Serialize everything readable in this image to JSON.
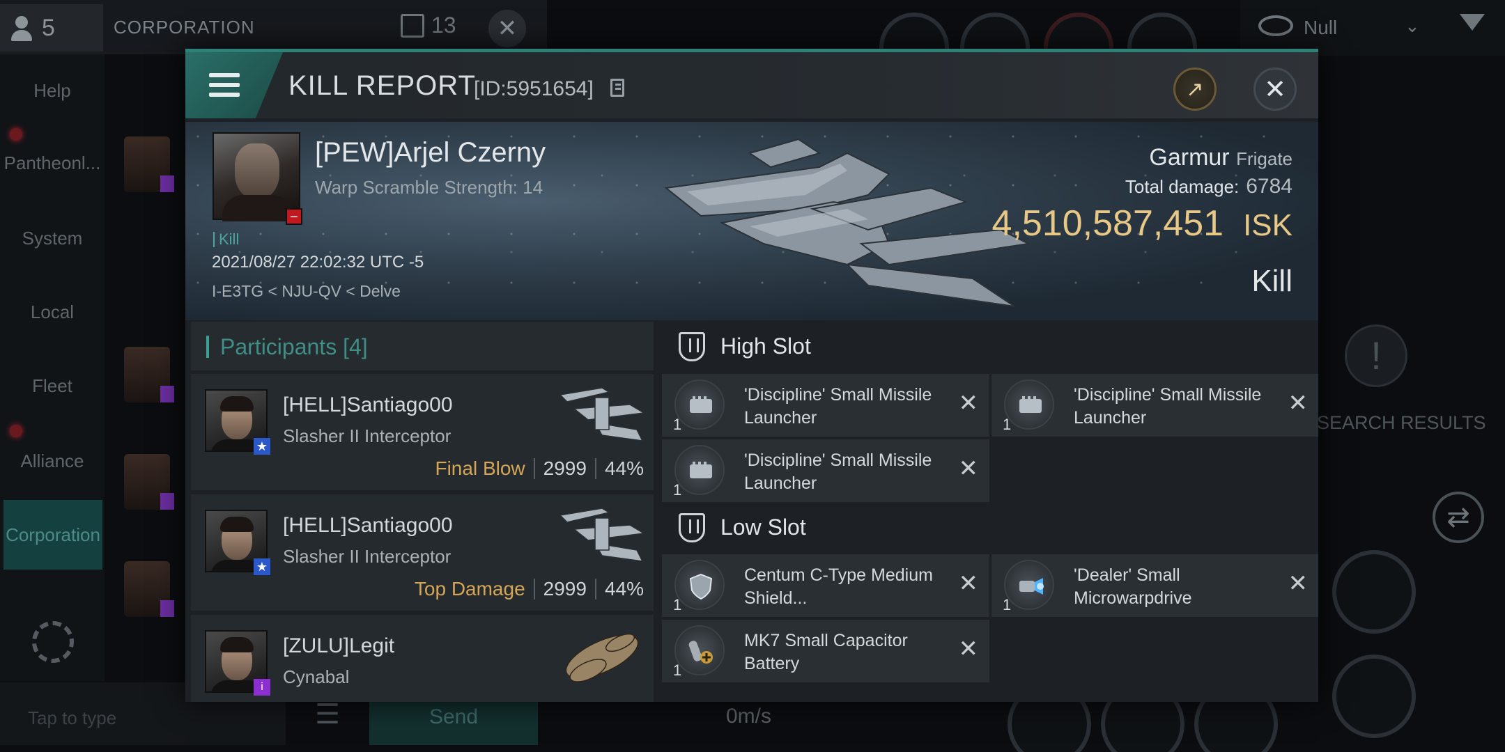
{
  "background": {
    "people_count": "5",
    "corp_title": "CORPORATION",
    "message_count": "13",
    "nav": [
      "Help",
      "Pantheonl...",
      "System",
      "Local",
      "Fleet",
      "Alliance",
      "Corporation"
    ],
    "chat_placeholder": "Tap to type",
    "send_label": "Send",
    "overview_filter": "Null",
    "search_results": "SEARCH RESULTS",
    "speed": "0m/s"
  },
  "header": {
    "title": "KILL REPORT",
    "id": "[ID:5951654]"
  },
  "victim": {
    "name": "[PEW]Arjel Czerny",
    "warp_scramble": "Warp Scramble Strength: 14",
    "kill_tag": "Kill",
    "datetime": "2021/08/27 22:02:32 UTC -5",
    "location": "I-E3TG < NJU-QV < Delve",
    "ship_name": "Garmur",
    "ship_class": "Frigate",
    "total_damage_label": "Total damage:",
    "total_damage": "6784",
    "isk_value": "4,510,587,451",
    "isk_label": "ISK",
    "result": "Kill"
  },
  "participants": {
    "title": "Participants",
    "count": "[4]",
    "list": [
      {
        "name": "[HELL]Santiago00",
        "ship": "Slasher II Interceptor",
        "tag": "Final Blow",
        "damage": "2999",
        "percent": "44%"
      },
      {
        "name": "[HELL]Santiago00",
        "ship": "Slasher II Interceptor",
        "tag": "Top Damage",
        "damage": "2999",
        "percent": "44%"
      },
      {
        "name": "[ZULU]Legit",
        "ship": "Cynabal"
      }
    ]
  },
  "slots": {
    "high": {
      "title": "High Slot",
      "items": [
        {
          "qty": "1",
          "name": "'Discipline' Small Missile Launcher"
        },
        {
          "qty": "1",
          "name": "'Discipline' Small Missile Launcher"
        },
        {
          "qty": "1",
          "name": "'Discipline' Small Missile Launcher"
        }
      ]
    },
    "low": {
      "title": "Low Slot",
      "items": [
        {
          "qty": "1",
          "name": "Centum C-Type Medium Shield..."
        },
        {
          "qty": "1",
          "name": "'Dealer' Small Microwarpdrive"
        },
        {
          "qty": "1",
          "name": "MK7 Small Capacitor Battery"
        }
      ]
    }
  },
  "colors": {
    "accent": "#2f8077",
    "isk": "#e8c887",
    "final_blow": "#d4a656"
  }
}
